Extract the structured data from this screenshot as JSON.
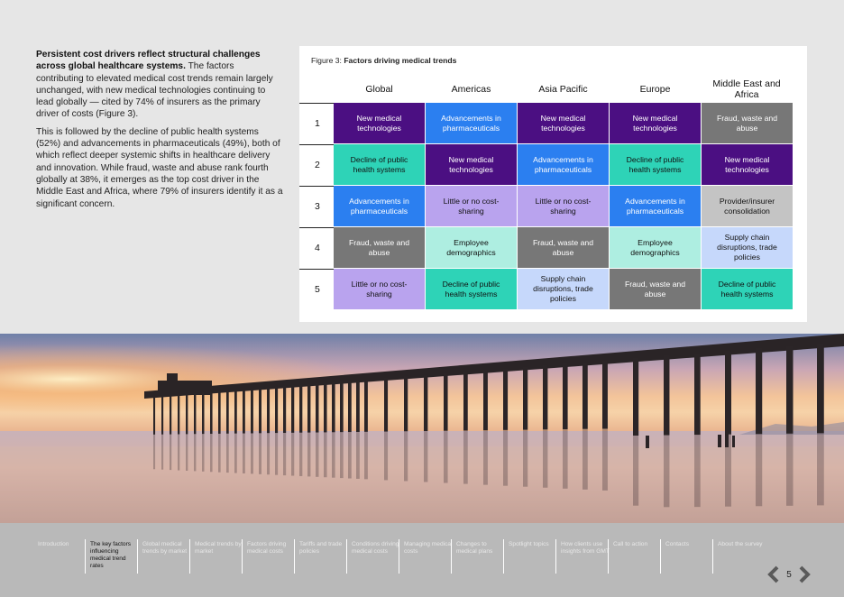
{
  "intro": {
    "lead_bold": "Persistent cost drivers reflect structural challenges across global healthcare systems.",
    "lead_rest": " The factors contributing to elevated medical cost trends remain largely unchanged, with new medical technologies continuing to lead globally — cited by 74% of insurers as the primary driver of costs (Figure 3).",
    "para2": "This is followed by the decline of public health systems (52%) and advancements in pharmaceuticals (49%), both of which reflect deeper systemic shifts in healthcare delivery and innovation. While fraud, waste and abuse rank fourth globally at 38%, it emerges as the top cost driver in the Middle East and Africa, where 79% of insurers identify it as a significant concern."
  },
  "figure": {
    "label": "Figure 3: ",
    "title": "Factors driving medical trends",
    "columns": [
      "Global",
      "Americas",
      "Asia Pacific",
      "Europe",
      "Middle East and Africa"
    ],
    "rows": [
      "1",
      "2",
      "3",
      "4",
      "5"
    ],
    "cells": [
      [
        "New medical technologies",
        "Advancements in pharmaceuticals",
        "New medical technologies",
        "New medical technologies",
        "Fraud, waste and abuse"
      ],
      [
        "Decline of public health systems",
        "New medical technologies",
        "Advancements in pharmaceuticals",
        "Decline of public health systems",
        "New medical technologies"
      ],
      [
        "Advancements in pharmaceuticals",
        "Little or no cost-sharing",
        "Little or no cost-sharing",
        "Advancements in pharmaceuticals",
        "Provider/insurer consolidation"
      ],
      [
        "Fraud, waste and abuse",
        "Employee demographics",
        "Fraud, waste and abuse",
        "Employee demographics",
        "Supply chain disruptions, trade policies"
      ],
      [
        "Little or no cost-sharing",
        "Decline of public health systems",
        "Supply chain disruptions, trade policies",
        "Fraud, waste and abuse",
        "Decline of public health systems"
      ]
    ],
    "colors": {
      "New medical technologies": "#4b0f82",
      "Advancements in pharmaceuticals": "#2b7ff0",
      "Decline of public health systems": "#2ed3b7",
      "Little or no cost-sharing": "#b9a3ee",
      "Fraud, waste and abuse": "#777777",
      "Employee demographics": "#aeeee1",
      "Supply chain disruptions, trade policies": "#c6d8fb",
      "Provider/insurer consolidation": "#c4c4c4"
    }
  },
  "nav": {
    "items": [
      "Introduction",
      "The key factors influencing medical trend rates",
      "Global medical trends by market",
      "Medical trends by market",
      "Factors driving medical costs",
      "Tariffs and trade policies",
      "Conditions driving medical costs",
      "Managing medical costs",
      "Changes to medical plans",
      "Spotlight topics",
      "How clients use insights from GMT",
      "Call to action",
      "Contacts",
      "About the survey"
    ],
    "active_index": 1,
    "page_number": "5"
  }
}
